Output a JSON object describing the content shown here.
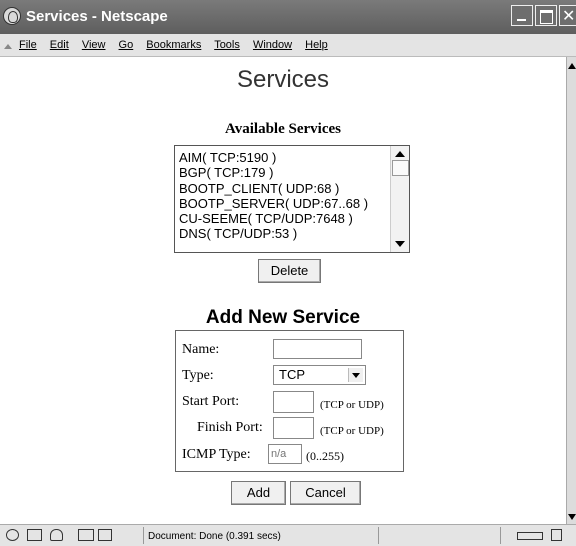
{
  "window": {
    "title": "Services - Netscape"
  },
  "menu": [
    "File",
    "Edit",
    "View",
    "Go",
    "Bookmarks",
    "Tools",
    "Window",
    "Help"
  ],
  "page": {
    "title": "Services",
    "available_title": "Available Services",
    "services": [
      "AIM( TCP:5190 )",
      "BGP( TCP:179 )",
      "BOOTP_CLIENT( UDP:68 )",
      "BOOTP_SERVER( UDP:67..68 )",
      "CU-SEEME( TCP/UDP:7648 )",
      "DNS( TCP/UDP:53 )"
    ],
    "delete_label": "Delete",
    "add_title": "Add New Service",
    "form": {
      "name_label": "Name:",
      "type_label": "Type:",
      "type_value": "TCP",
      "start_label": "Start Port:",
      "start_hint": "(TCP or UDP)",
      "finish_label": "Finish Port:",
      "finish_hint": "(TCP or UDP)",
      "icmp_label": "ICMP Type:",
      "icmp_placeholder": "n/a",
      "icmp_hint": "(0..255)"
    },
    "add_label": "Add",
    "cancel_label": "Cancel"
  },
  "status": {
    "text": "Document: Done (0.391 secs)"
  }
}
